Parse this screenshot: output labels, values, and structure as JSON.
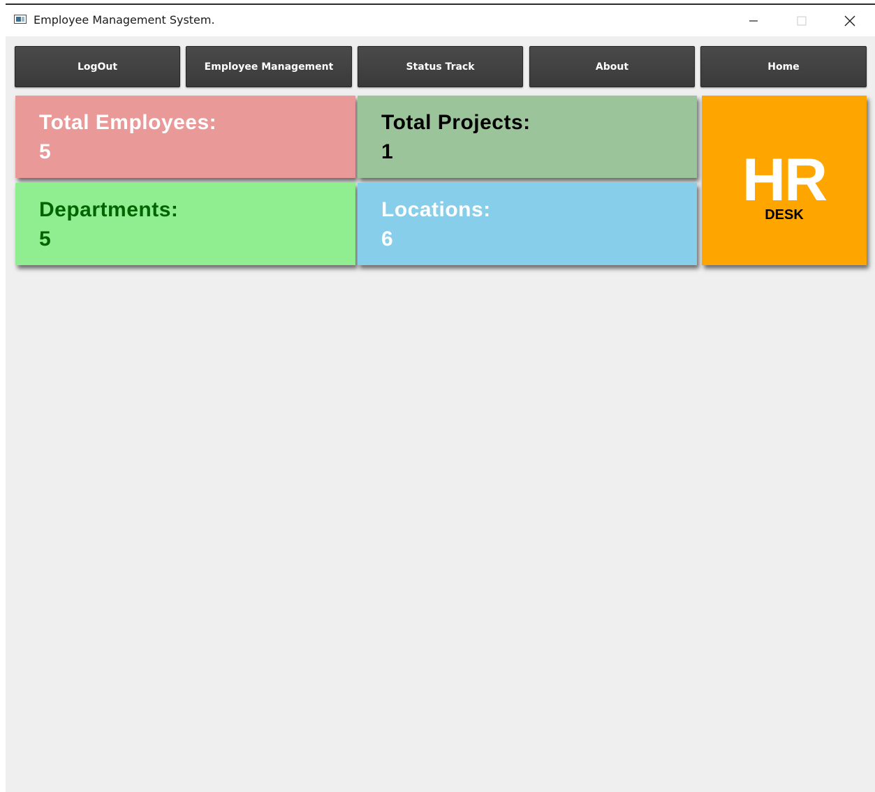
{
  "window": {
    "title": "Employee Management System."
  },
  "nav": {
    "items": [
      {
        "label": "LogOut"
      },
      {
        "label": "Employee Management"
      },
      {
        "label": "Status Track"
      },
      {
        "label": "About"
      },
      {
        "label": "Home"
      }
    ]
  },
  "stats": {
    "employees": {
      "label": "Total Employees:",
      "value": "5",
      "color": "#ea9999"
    },
    "projects": {
      "label": "Total Projects:",
      "value": "1",
      "color": "#9bc49b"
    },
    "departments": {
      "label": "Departments:",
      "value": "5",
      "color": "#90ee90"
    },
    "locations": {
      "label": "Locations:",
      "value": "6",
      "color": "#87ceeb"
    }
  },
  "logo": {
    "main": "HR",
    "sub": "DESK",
    "color": "#ffa500"
  },
  "icons": {
    "app": "app-window-icon",
    "minimize": "minimize-icon",
    "maximize": "maximize-icon",
    "close": "close-icon"
  }
}
